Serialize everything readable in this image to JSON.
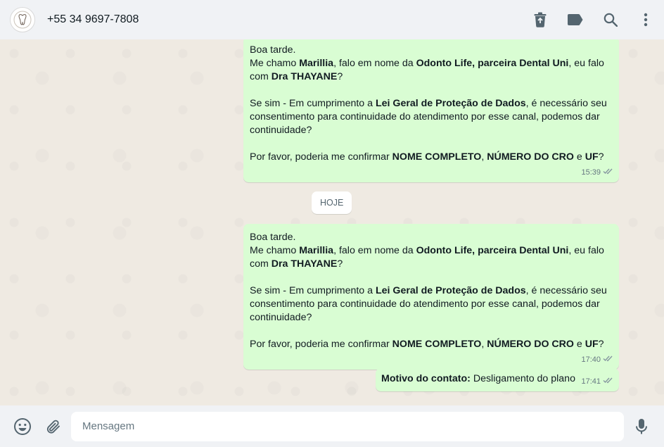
{
  "header": {
    "contact_name": "+55 34 9697-7808",
    "icons": [
      "trash-icon",
      "label-icon",
      "search-icon",
      "menu-icon"
    ]
  },
  "messages": [
    {
      "paragraphs": [
        [
          {
            "t": "Boa tarde."
          }
        ],
        [
          {
            "t": "Me chamo "
          },
          {
            "t": "Marillia",
            "b": true
          },
          {
            "t": ", falo em nome da "
          },
          {
            "t": "Odonto Life, parceira Dental Uni",
            "b": true
          },
          {
            "t": ", eu falo com "
          },
          {
            "t": "Dra THAYANE",
            "b": true
          },
          {
            "t": "?"
          }
        ],
        [],
        [
          {
            "t": "Se sim - Em cumprimento a "
          },
          {
            "t": "Lei Geral de Proteção de Dados",
            "b": true
          },
          {
            "t": ", é necessário seu consentimento para continuidade do atendimento por esse canal, podemos dar continuidade?"
          }
        ],
        [],
        [
          {
            "t": "Por favor, poderia me confirmar "
          },
          {
            "t": "NOME COMPLETO",
            "b": true
          },
          {
            "t": ", "
          },
          {
            "t": "NÚMERO DO CRO",
            "b": true
          },
          {
            "t": " e "
          },
          {
            "t": "UF",
            "b": true
          },
          {
            "t": "?"
          }
        ]
      ],
      "time": "15:39"
    },
    {
      "paragraphs": [
        [
          {
            "t": "Boa tarde."
          }
        ],
        [
          {
            "t": "Me chamo "
          },
          {
            "t": "Marillia",
            "b": true
          },
          {
            "t": ", falo em nome da "
          },
          {
            "t": "Odonto Life, parceira Dental Uni",
            "b": true
          },
          {
            "t": ", eu falo com "
          },
          {
            "t": "Dra THAYANE",
            "b": true
          },
          {
            "t": "?"
          }
        ],
        [],
        [
          {
            "t": "Se sim - Em cumprimento a "
          },
          {
            "t": "Lei Geral de Proteção de Dados",
            "b": true
          },
          {
            "t": ", é necessário seu consentimento para continuidade do atendimento por esse canal, podemos dar continuidade?"
          }
        ],
        [],
        [
          {
            "t": "Por favor, poderia me confirmar "
          },
          {
            "t": "NOME COMPLETO",
            "b": true
          },
          {
            "t": ", "
          },
          {
            "t": "NÚMERO DO CRO",
            "b": true
          },
          {
            "t": " e "
          },
          {
            "t": "UF",
            "b": true
          },
          {
            "t": "?"
          }
        ]
      ],
      "time": "17:40"
    },
    {
      "paragraphs": [
        [
          {
            "t": "Motivo do contato:",
            "b": true
          },
          {
            "t": " Desligamento do plano"
          }
        ]
      ],
      "time": "17:41"
    }
  ],
  "date_divider": "HOJE",
  "composer": {
    "placeholder": "Mensagem",
    "value": ""
  },
  "colors": {
    "outgoing_bubble": "#d9fdd3",
    "chat_background": "#efeae2",
    "bar_background": "#f0f2f5",
    "icon": "#54656f"
  }
}
